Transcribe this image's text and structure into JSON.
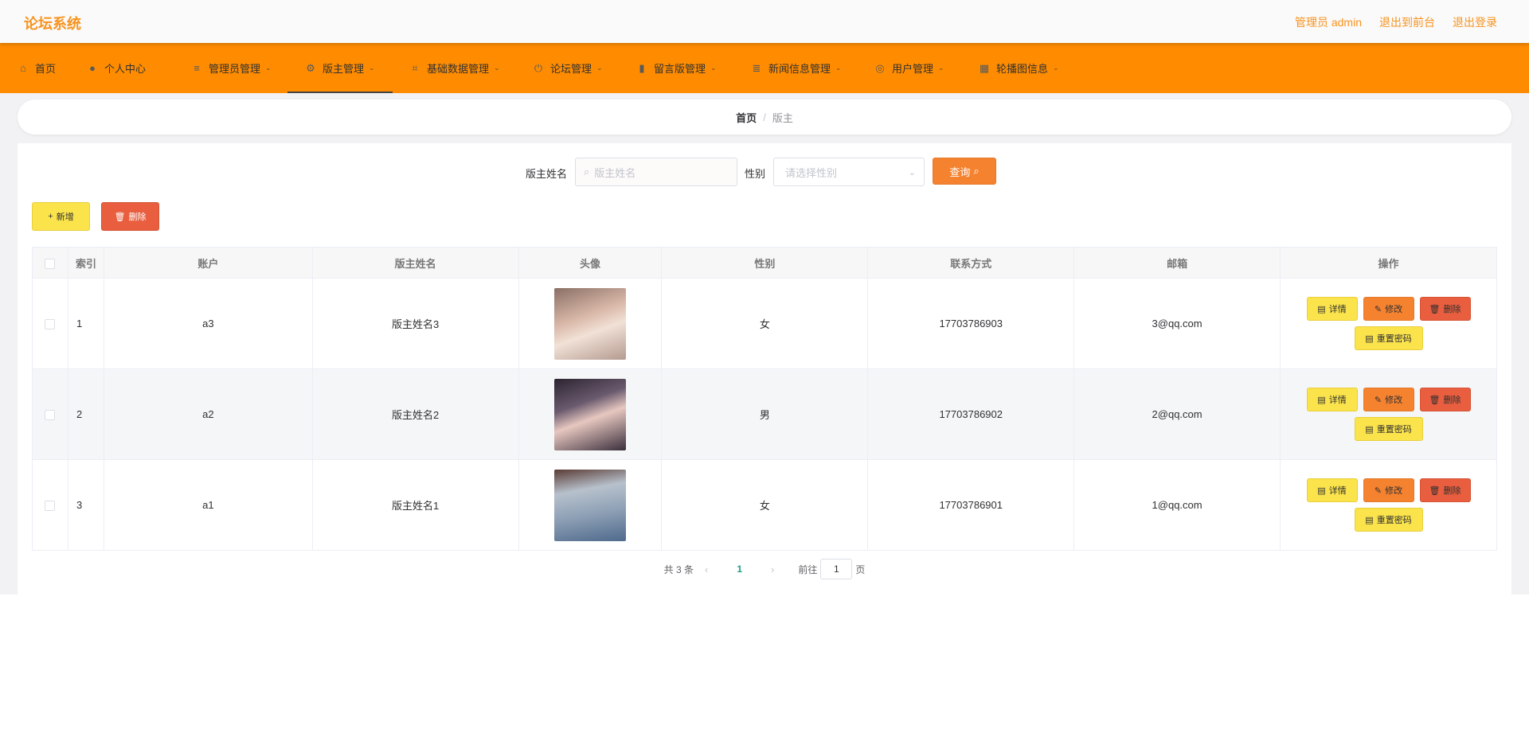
{
  "header": {
    "brand": "论坛系统",
    "admin_label": "管理员 admin",
    "front_link": "退出到前台",
    "logout_link": "退出登录"
  },
  "nav": {
    "items": [
      {
        "label": "首页",
        "icon": "home-icon",
        "has_caret": false
      },
      {
        "label": "个人中心",
        "icon": "user-icon",
        "has_caret": false
      },
      {
        "label": "管理员管理",
        "icon": "list-icon",
        "has_caret": true
      },
      {
        "label": "版主管理",
        "icon": "moderator-icon",
        "has_caret": true
      },
      {
        "label": "基础数据管理",
        "icon": "data-icon",
        "has_caret": true
      },
      {
        "label": "论坛管理",
        "icon": "power-icon",
        "has_caret": true
      },
      {
        "label": "留言版管理",
        "icon": "chart-icon",
        "has_caret": true
      },
      {
        "label": "新闻信息管理",
        "icon": "news-icon",
        "has_caret": true
      },
      {
        "label": "用户管理",
        "icon": "users-icon",
        "has_caret": true
      },
      {
        "label": "轮播图信息",
        "icon": "grid-icon",
        "has_caret": true
      }
    ],
    "active": "版主管理",
    "colors": {
      "bar": "#ff8c00",
      "brand": "#f7931e"
    }
  },
  "breadcrumb": {
    "home": "首页",
    "separator": "/",
    "current": "版主"
  },
  "search": {
    "name_label": "版主姓名",
    "name_placeholder": "版主姓名",
    "gender_label": "性别",
    "gender_placeholder": "请选择性别",
    "button": "查询"
  },
  "actions": {
    "add": "新增",
    "delete": "删除"
  },
  "table": {
    "headers": [
      "索引",
      "账户",
      "版主姓名",
      "头像",
      "性别",
      "联系方式",
      "邮箱",
      "操作"
    ],
    "rows": [
      {
        "index": "1",
        "account": "a3",
        "name": "版主姓名3",
        "gender": "女",
        "phone": "17703786903",
        "email": "3@qq.com"
      },
      {
        "index": "2",
        "account": "a2",
        "name": "版主姓名2",
        "gender": "男",
        "phone": "17703786902",
        "email": "2@qq.com"
      },
      {
        "index": "3",
        "account": "a1",
        "name": "版主姓名1",
        "gender": "女",
        "phone": "17703786901",
        "email": "1@qq.com"
      }
    ],
    "ops": {
      "detail": "详情",
      "edit": "修改",
      "delete": "删除",
      "reset": "重置密码"
    }
  },
  "pagination": {
    "total": "共 3 条",
    "current_page": "1",
    "goto_prefix": "前往",
    "goto_value": "1",
    "goto_suffix": "页"
  }
}
